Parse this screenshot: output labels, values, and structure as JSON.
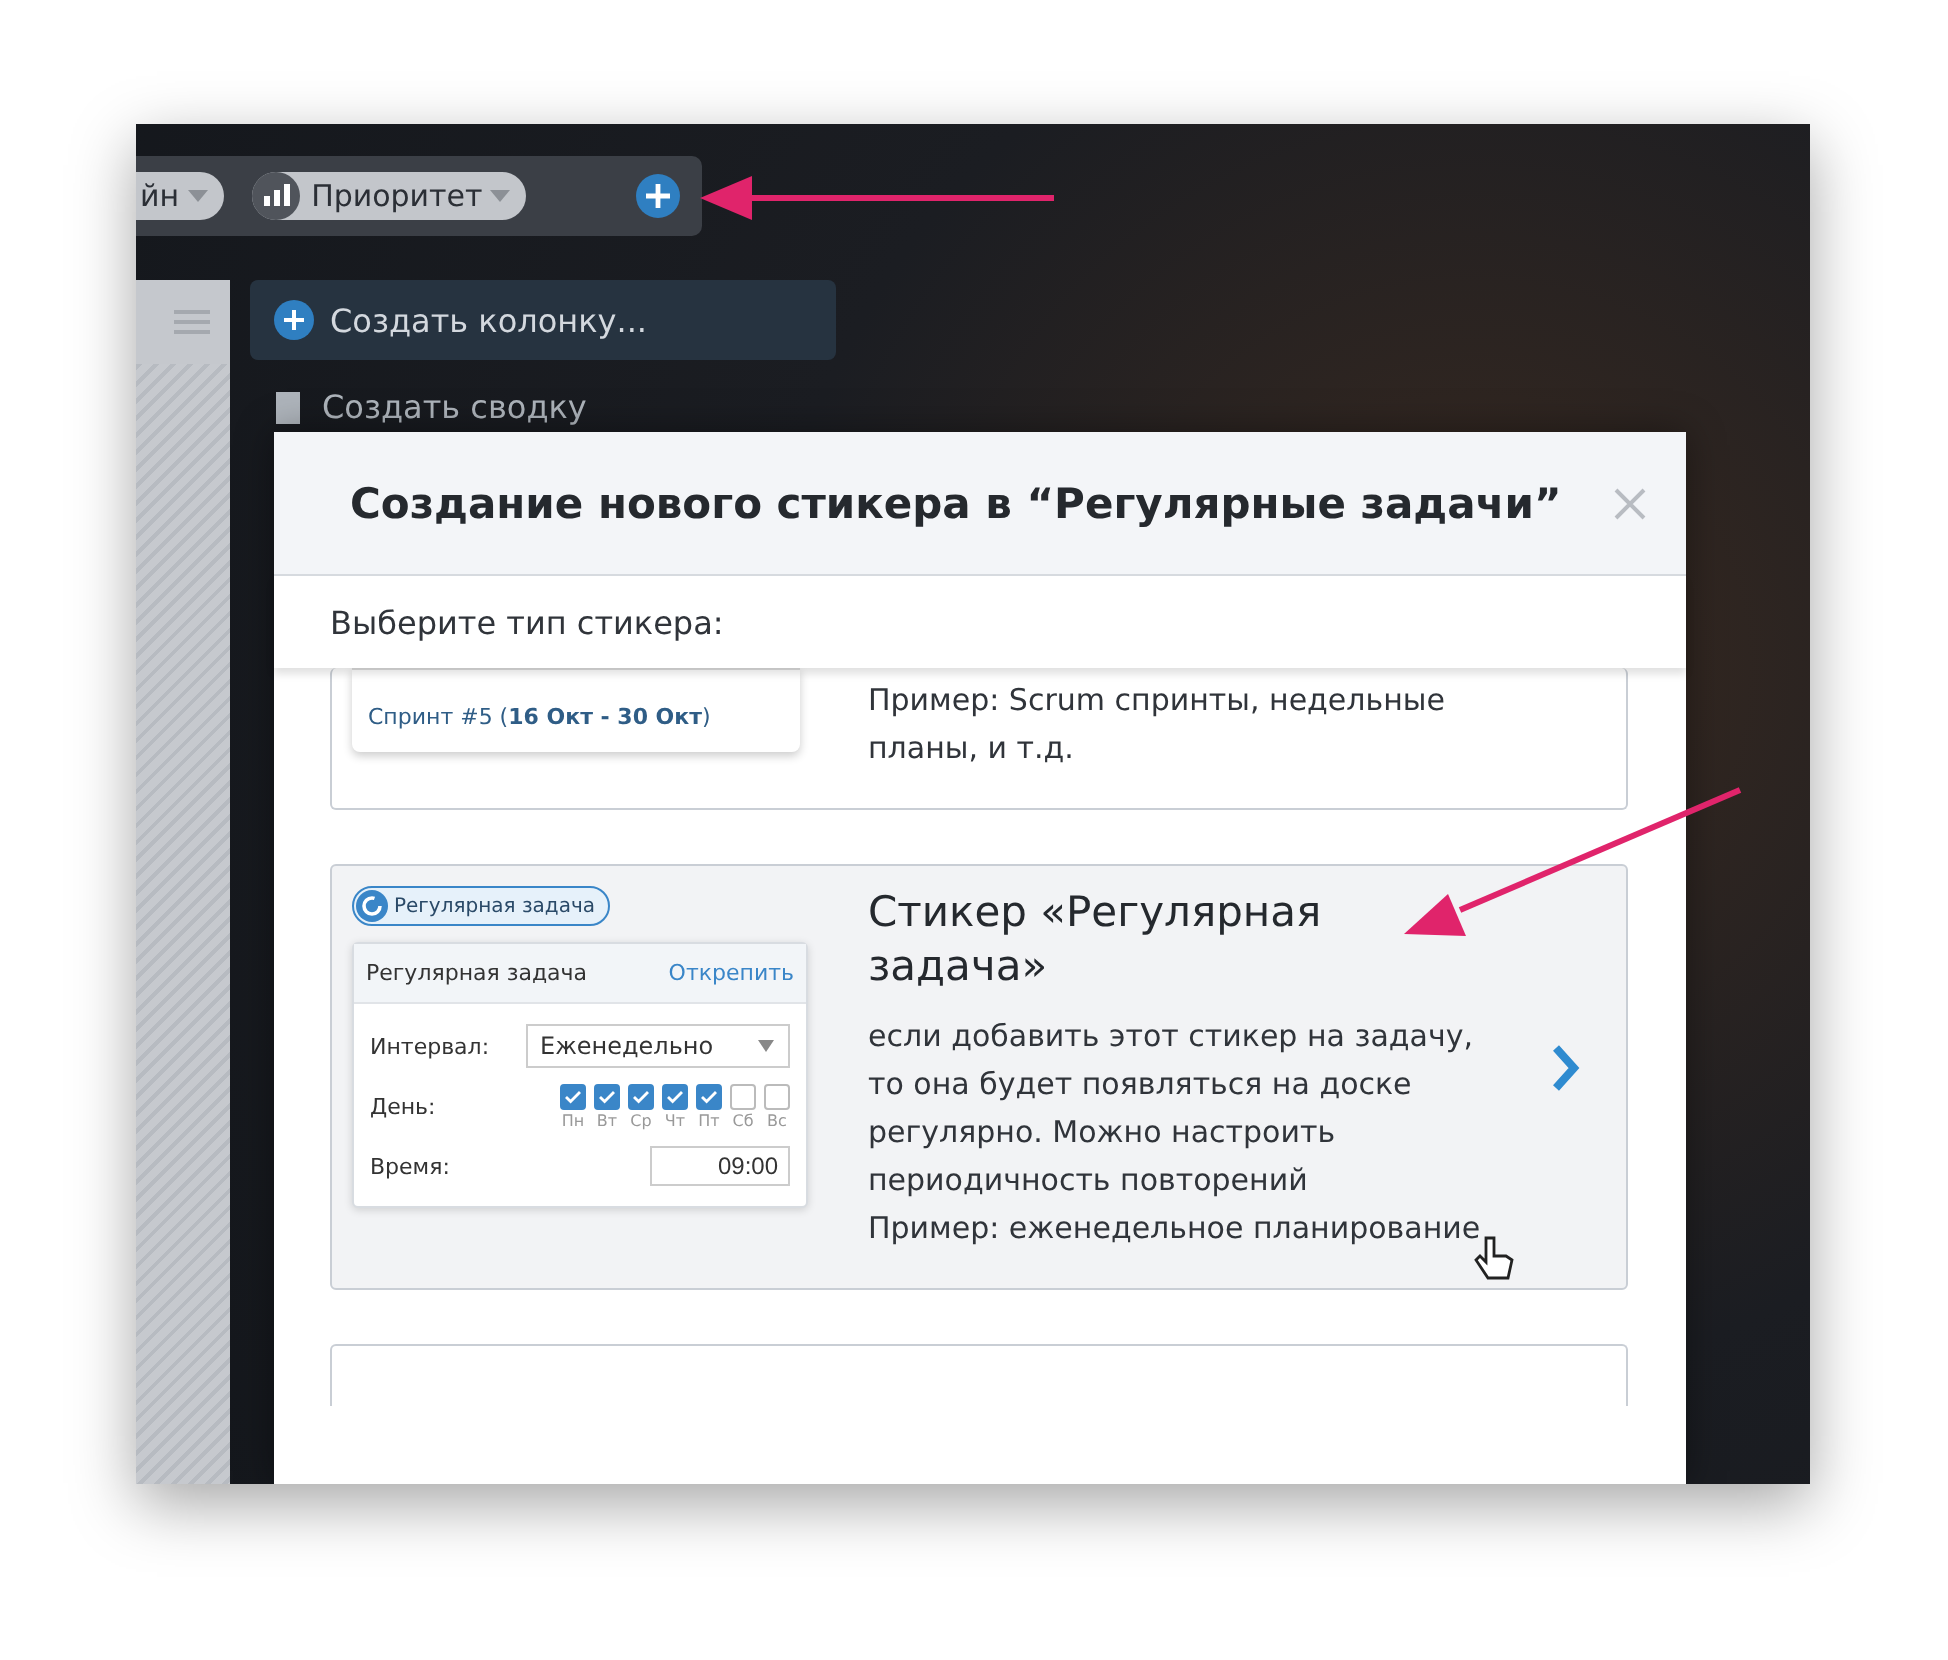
{
  "toolbar": {
    "filters": [
      {
        "label": "йн",
        "kind": "plain"
      },
      {
        "label": "Приоритет",
        "kind": "priority"
      }
    ]
  },
  "board": {
    "create_column": "Создать колонку...",
    "create_summary": "Создать сводку"
  },
  "dialog": {
    "title": "Создание нового стикера в “Регулярные задачи”",
    "subtitle": "Выберите тип стикера:",
    "options": [
      {
        "kind": "sprint",
        "selected": false,
        "preview": {
          "sprint": "Спринт #5 (**16 Окт - 30 Окт**)"
        },
        "example": "Пример: Scrum спринты, недельные планы, и т.д."
      },
      {
        "kind": "recurring",
        "selected": true,
        "badge": "Регулярная задача",
        "preview": {
          "header": "Регулярная задача",
          "unpin": "Открепить",
          "interval_label": "Интервал:",
          "interval": "Еженедельно",
          "day_label": "День:",
          "days": [
            {
              "label": "Пн",
              "checked": true
            },
            {
              "label": "Вт",
              "checked": true
            },
            {
              "label": "Ср",
              "checked": true
            },
            {
              "label": "Чт",
              "checked": true
            },
            {
              "label": "Пт",
              "checked": true
            },
            {
              "label": "Сб",
              "checked": false
            },
            {
              "label": "Вс",
              "checked": false
            }
          ],
          "time_label": "Время:",
          "time": "09:00"
        },
        "title": "Стикер «Регулярная задача»",
        "description": "если добавить этот стикер на задачу, то она будет появляться на доске регулярно. Можно настроить периодичность повторений",
        "example": "Пример: еженедельное планирование"
      }
    ]
  }
}
